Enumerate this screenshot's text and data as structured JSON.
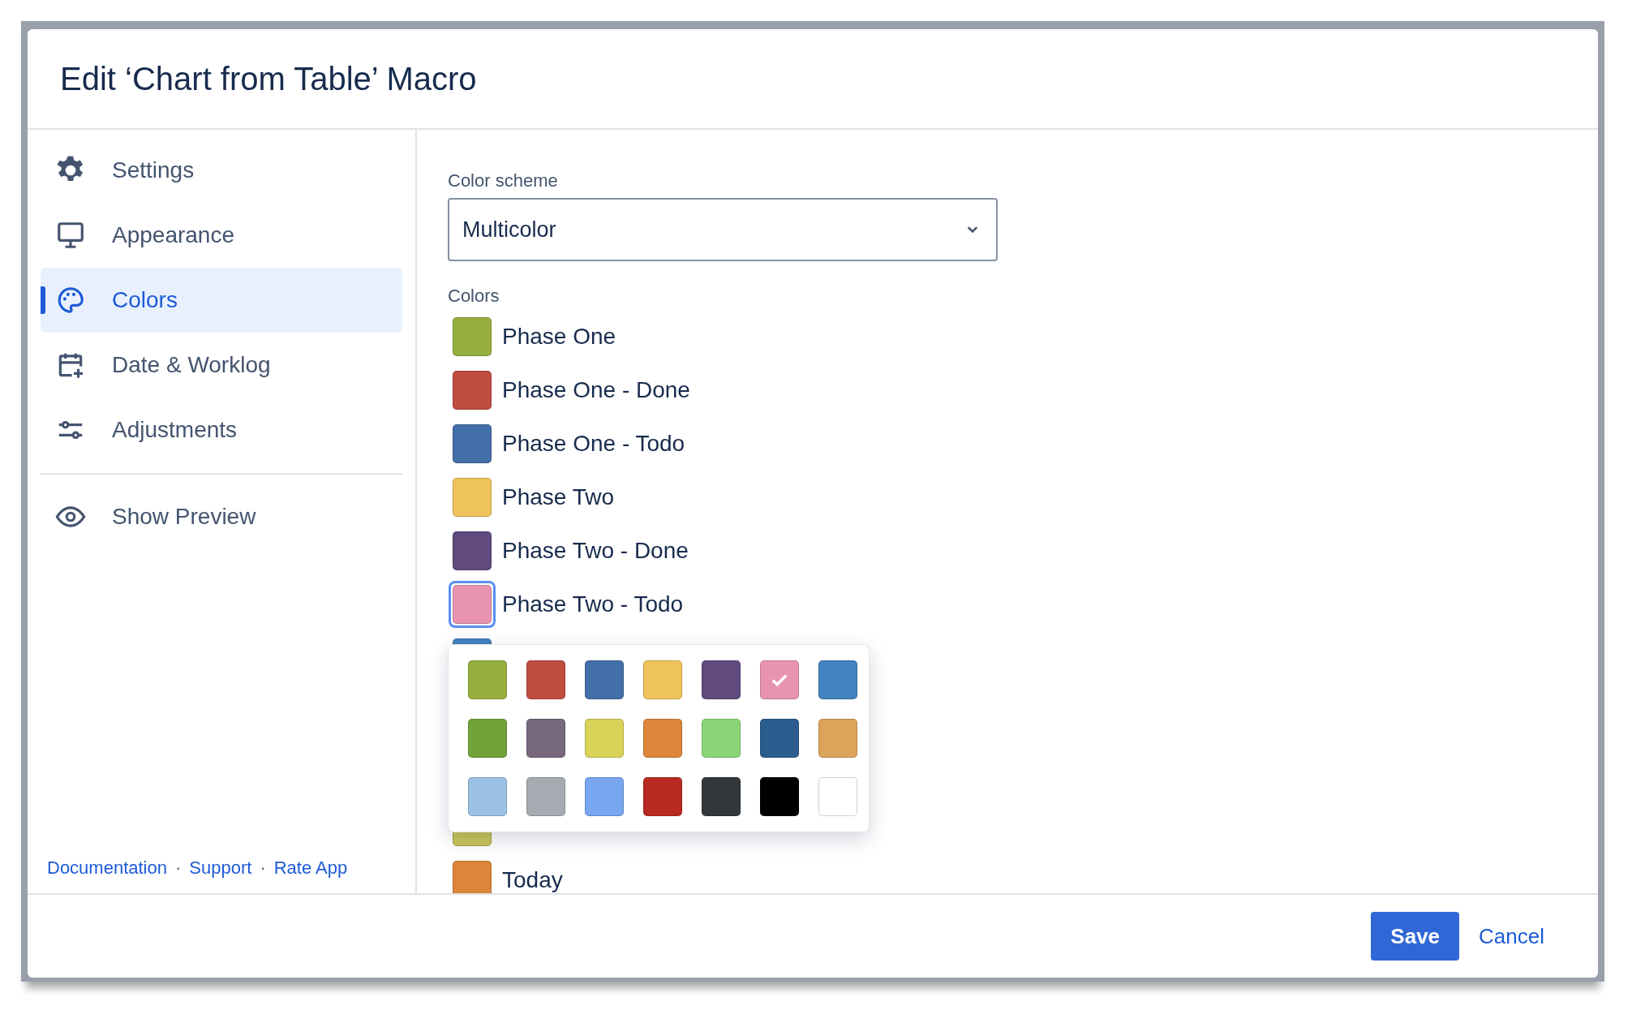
{
  "dialog": {
    "title": "Edit ‘Chart from Table’ Macro"
  },
  "sidebar": {
    "items": [
      {
        "label": "Settings",
        "selected": false
      },
      {
        "label": "Appearance",
        "selected": false
      },
      {
        "label": "Colors",
        "selected": true
      },
      {
        "label": "Date & Worklog",
        "selected": false
      },
      {
        "label": "Adjustments",
        "selected": false
      }
    ],
    "preview": {
      "label": "Show Preview"
    },
    "links": [
      {
        "label": "Documentation"
      },
      {
        "label": "Support"
      },
      {
        "label": "Rate App"
      }
    ],
    "separator": "·"
  },
  "color_scheme": {
    "label": "Color scheme",
    "value": "Multicolor"
  },
  "colors": {
    "label": "Colors",
    "items": [
      {
        "label": "Phase One",
        "color": "#95ae3e",
        "selected": false
      },
      {
        "label": "Phase One - Done",
        "color": "#c04d3f",
        "selected": false
      },
      {
        "label": "Phase One - Todo",
        "color": "#426fa8",
        "selected": false
      },
      {
        "label": "Phase Two",
        "color": "#eec35a",
        "selected": false
      },
      {
        "label": "Phase Two - Done",
        "color": "#604a7e",
        "selected": false
      },
      {
        "label": "Phase Two - Todo",
        "color": "#e894ae",
        "selected": true
      },
      {
        "color": "#4382c0",
        "selected": false
      },
      {
        "color": "#c9c55a",
        "selected": false
      },
      {
        "label": "Today",
        "color": "#dc853b",
        "selected": false
      }
    ]
  },
  "palette": [
    {
      "color": "#95ae3e",
      "selected": false
    },
    {
      "color": "#c04d3f",
      "selected": false
    },
    {
      "color": "#426fa8",
      "selected": false
    },
    {
      "color": "#eec35a",
      "selected": false
    },
    {
      "color": "#604a7e",
      "selected": false
    },
    {
      "color": "#e894ae",
      "selected": true
    },
    {
      "color": "#4382c0",
      "selected": false
    },
    {
      "color": "#72a23a",
      "selected": false
    },
    {
      "color": "#77677f",
      "selected": false
    },
    {
      "color": "#d9d35a",
      "selected": false
    },
    {
      "color": "#dc853b",
      "selected": false
    },
    {
      "color": "#8ad676",
      "selected": false
    },
    {
      "color": "#2b5d8f",
      "selected": false
    },
    {
      "color": "#dba45a",
      "selected": false
    },
    {
      "color": "#9bc1e4",
      "selected": false
    },
    {
      "color": "#a5abb1",
      "selected": false
    },
    {
      "color": "#78a6ef",
      "selected": false
    },
    {
      "color": "#b72b22",
      "selected": false
    },
    {
      "color": "#32373b",
      "selected": false
    },
    {
      "color": "#000000",
      "selected": false
    },
    {
      "color": "#ffffff",
      "selected": false
    }
  ],
  "footer": {
    "save": "Save",
    "cancel": "Cancel"
  }
}
